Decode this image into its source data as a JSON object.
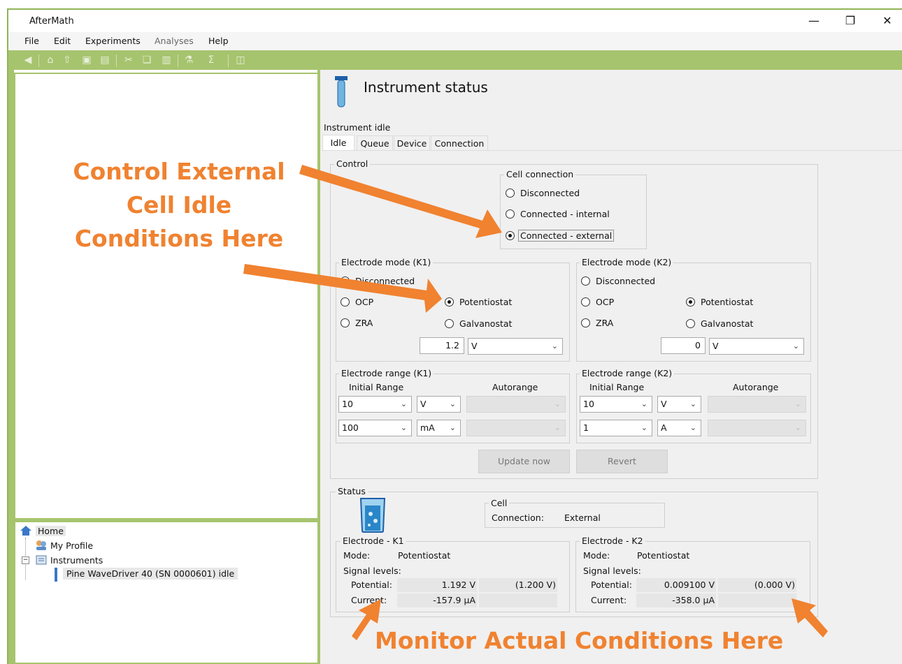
{
  "window": {
    "title": "AfterMath"
  },
  "menu": {
    "file": "File",
    "edit": "Edit",
    "experiments": "Experiments",
    "analyses": "Analyses",
    "help": "Help"
  },
  "tree": {
    "home": "Home",
    "profile": "My Profile",
    "instruments": "Instruments",
    "device": "Pine WaveDriver 40 (SN 0000601) idle"
  },
  "panel": {
    "title": "Instrument status",
    "state": "Instrument idle"
  },
  "tabs": [
    "Idle",
    "Queue",
    "Device",
    "Connection"
  ],
  "control": {
    "label": "Control",
    "cell_connection": {
      "label": "Cell connection",
      "options": [
        "Disconnected",
        "Connected - internal",
        "Connected - external"
      ],
      "selected": "Connected - external"
    },
    "k1": {
      "label": "Electrode mode (K1)",
      "disconnected": "Disconnected",
      "ocp": "OCP",
      "zra": "ZRA",
      "potentiostat": "Potentiostat",
      "galvanostat": "Galvanostat",
      "selected": "Potentiostat",
      "value": "1.2",
      "unit": "V"
    },
    "k2": {
      "label": "Electrode mode (K2)",
      "disconnected": "Disconnected",
      "ocp": "OCP",
      "zra": "ZRA",
      "potentiostat": "Potentiostat",
      "galvanostat": "Galvanostat",
      "selected": "Potentiostat",
      "value": "0",
      "unit": "V"
    },
    "range_k1": {
      "label": "Electrode range (K1)",
      "initial": "Initial Range",
      "autorange": "Autorange",
      "v_value": "10",
      "v_unit": "V",
      "i_value": "100",
      "i_unit": "mA"
    },
    "range_k2": {
      "label": "Electrode range (K2)",
      "initial": "Initial Range",
      "autorange": "Autorange",
      "v_value": "10",
      "v_unit": "V",
      "i_value": "1",
      "i_unit": "A"
    },
    "update": "Update now",
    "revert": "Revert"
  },
  "status": {
    "label": "Status",
    "cell": {
      "label": "Cell",
      "connection_label": "Connection:",
      "connection_value": "External"
    },
    "k1": {
      "label": "Electrode - K1",
      "mode_label": "Mode:",
      "mode": "Potentiostat",
      "signal": "Signal levels:",
      "potential_label": "Potential:",
      "potential": "1.192 V",
      "potential_set": "(1.200 V)",
      "current_label": "Current:",
      "current": "-157.9 μA"
    },
    "k2": {
      "label": "Electrode - K2",
      "mode_label": "Mode:",
      "mode": "Potentiostat",
      "signal": "Signal levels:",
      "potential_label": "Potential:",
      "potential": "0.009100 V",
      "potential_set": "(0.000 V)",
      "current_label": "Current:",
      "current": "-358.0 μA"
    }
  },
  "annotations": {
    "control_line1": "Control External",
    "control_line2": "Cell Idle",
    "control_line3": "Conditions Here",
    "monitor": "Monitor Actual Conditions Here",
    "color": "#f08230"
  }
}
